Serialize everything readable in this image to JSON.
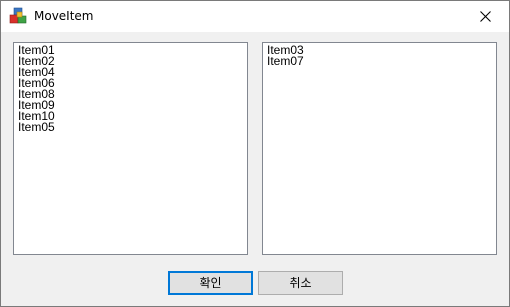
{
  "window": {
    "title": "MoveItem",
    "app_icon": "app-cubes-icon",
    "close_icon": "close-icon"
  },
  "left_list": {
    "items": [
      "Item01",
      "Item02",
      "Item04",
      "Item06",
      "Item08",
      "Item09",
      "Item10",
      "Item05"
    ]
  },
  "right_list": {
    "items": [
      "Item03",
      "Item07"
    ]
  },
  "buttons": {
    "ok_label": "확인",
    "cancel_label": "취소"
  },
  "colors": {
    "accent": "#0078d7",
    "dialog_bg": "#f0f0f0"
  }
}
